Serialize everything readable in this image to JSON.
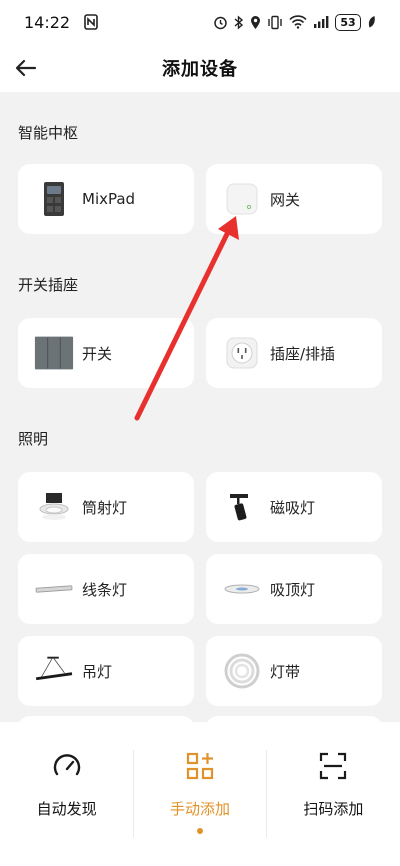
{
  "status_bar": {
    "time": "14:22",
    "battery": "53"
  },
  "header": {
    "title": "添加设备"
  },
  "sections": [
    {
      "title": "智能中枢",
      "items": [
        {
          "label": "MixPad",
          "icon": "mixpad-panel-icon"
        },
        {
          "label": "网关",
          "icon": "gateway-box-icon"
        }
      ]
    },
    {
      "title": "开关插座",
      "items": [
        {
          "label": "开关",
          "icon": "wall-switch-icon"
        },
        {
          "label": "插座/排插",
          "icon": "socket-icon"
        }
      ]
    },
    {
      "title": "照明",
      "items": [
        {
          "label": "筒射灯",
          "icon": "downlight-icon"
        },
        {
          "label": "磁吸灯",
          "icon": "magnetic-light-icon"
        },
        {
          "label": "线条灯",
          "icon": "linear-light-icon"
        },
        {
          "label": "吸顶灯",
          "icon": "ceiling-light-icon"
        },
        {
          "label": "吊灯",
          "icon": "pendant-light-icon"
        },
        {
          "label": "灯带",
          "icon": "light-strip-icon"
        }
      ]
    }
  ],
  "bottom_nav": {
    "items": [
      {
        "label": "自动发现",
        "icon": "auto-discover-icon"
      },
      {
        "label": "手动添加",
        "icon": "manual-add-icon"
      },
      {
        "label": "扫码添加",
        "icon": "scan-icon"
      }
    ],
    "active_index": 1,
    "active_color": "#e0932a"
  },
  "annotation": {
    "color": "#e8302e"
  }
}
